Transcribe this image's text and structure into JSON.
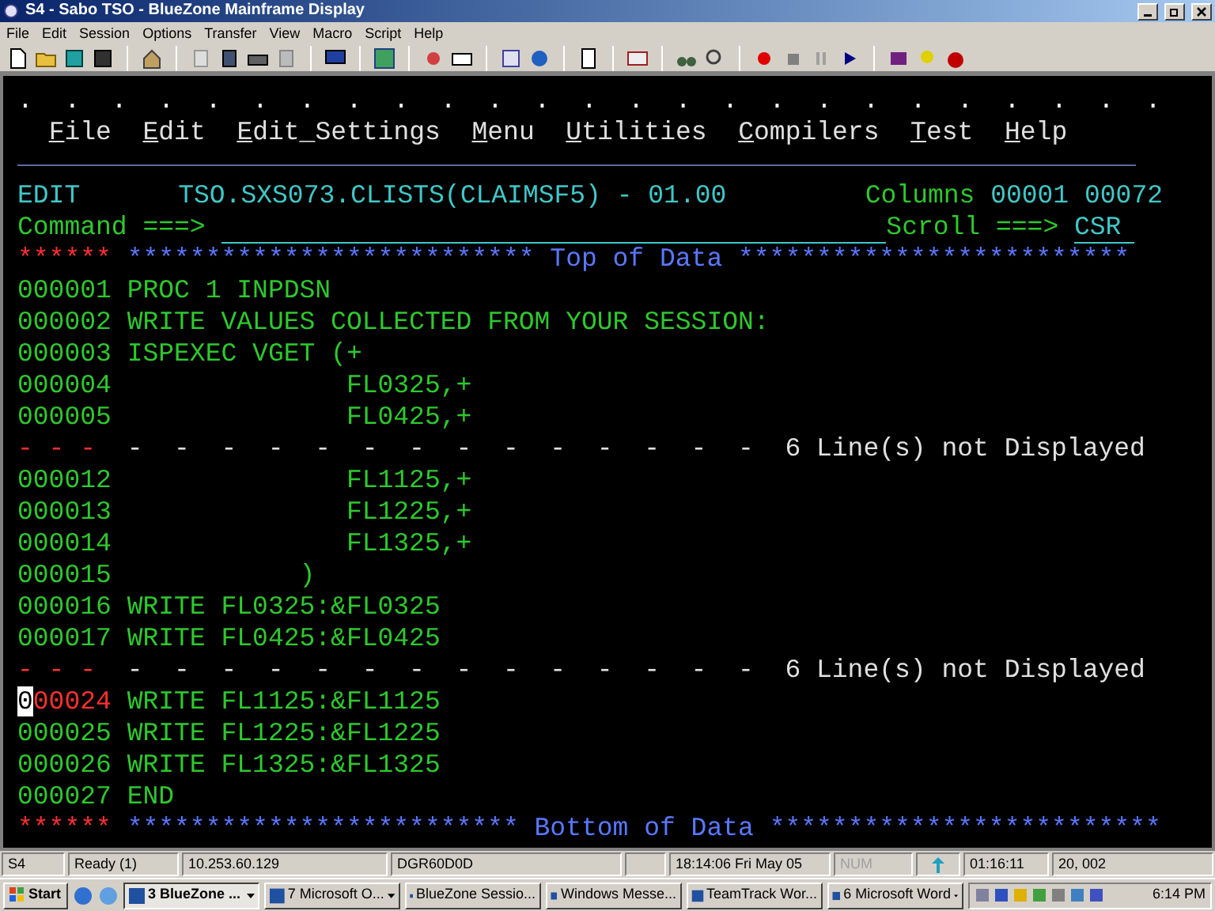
{
  "window": {
    "title": "S4 - Sabo TSO - BlueZone Mainframe Display"
  },
  "menu_bar": [
    "File",
    "Edit",
    "Session",
    "Options",
    "Transfer",
    "View",
    "Macro",
    "Script",
    "Help"
  ],
  "terminal": {
    "dots": ".  .  .  .  .  .  .  .  .  .  .  .  .  .  .  .  .  .  .  .  .  .  .  .  .",
    "ispf_menu": [
      "File",
      "Edit",
      "Edit_Settings",
      "Menu",
      "Utilities",
      "Compilers",
      "Test",
      "Help"
    ],
    "header": {
      "mode": "EDIT",
      "dataset": "TSO.SXS073.CLISTS(CLAIMSF5) - 01.00",
      "columns_label": "Columns",
      "columns_value": "00001 00072"
    },
    "command": {
      "label": "Command ===>",
      "scroll_label": "Scroll ===>",
      "scroll_value": "CSR"
    },
    "lines": [
      {
        "kind": "banner",
        "stars_left": "****** **************************",
        "label": "Top of Data",
        "stars_right": "*************************"
      },
      {
        "kind": "data",
        "number": "000001",
        "text": "PROC 1 INPDSN",
        "marked": false
      },
      {
        "kind": "data",
        "number": "000002",
        "text": "WRITE VALUES COLLECTED FROM YOUR SESSION:",
        "marked": false
      },
      {
        "kind": "data",
        "number": "000003",
        "text": "ISPEXEC VGET (+",
        "marked": false
      },
      {
        "kind": "data",
        "number": "000004",
        "text": "              FL0325,+",
        "marked": false
      },
      {
        "kind": "data",
        "number": "000005",
        "text": "              FL0425,+",
        "marked": false
      },
      {
        "kind": "excluded",
        "prefix": "- - -",
        "dashes": "  -  -  -  -  -  -  -  -  -  -  -  -  -  -",
        "label": "6 Line(s) not Displayed"
      },
      {
        "kind": "data",
        "number": "000012",
        "text": "              FL1125,+",
        "marked": false
      },
      {
        "kind": "data",
        "number": "000013",
        "text": "              FL1225,+",
        "marked": false
      },
      {
        "kind": "data",
        "number": "000014",
        "text": "              FL1325,+",
        "marked": false
      },
      {
        "kind": "data",
        "number": "000015",
        "text": "           )",
        "marked": false
      },
      {
        "kind": "data",
        "number": "000016",
        "text": "WRITE FL0325:&FL0325",
        "marked": false
      },
      {
        "kind": "data",
        "number": "000017",
        "text": "WRITE FL0425:&FL0425",
        "marked": false
      },
      {
        "kind": "excluded",
        "prefix": "- - -",
        "dashes": "  -  -  -  -  -  -  -  -  -  -  -  -  -  -",
        "label": "6 Line(s) not Displayed"
      },
      {
        "kind": "data",
        "number": "000024",
        "text": "WRITE FL1125:&FL1125",
        "marked": true
      },
      {
        "kind": "data",
        "number": "000025",
        "text": "WRITE FL1225:&FL1225",
        "marked": false
      },
      {
        "kind": "data",
        "number": "000026",
        "text": "WRITE FL1325:&FL1325",
        "marked": false
      },
      {
        "kind": "data",
        "number": "000027",
        "text": "END",
        "marked": false
      },
      {
        "kind": "banner",
        "stars_left": "****** *************************",
        "label": "Bottom of Data",
        "stars_right": "*************************"
      }
    ]
  },
  "status_bar": [
    {
      "text": "S4",
      "disabled": false
    },
    {
      "text": "Ready (1)",
      "disabled": false
    },
    {
      "text": "10.253.60.129",
      "disabled": false
    },
    {
      "text": "DGR60D0D",
      "disabled": false
    },
    {
      "text": "18:14:06  Fri May 05",
      "disabled": false
    },
    {
      "text": "NUM",
      "disabled": true
    },
    {
      "text": "01:16:11",
      "disabled": false
    },
    {
      "text": "20, 002",
      "disabled": false
    }
  ],
  "taskbar": {
    "start": "Start",
    "buttons": [
      {
        "label": "3 BlueZone ...",
        "selected": true,
        "group": true
      },
      {
        "label": "7 Microsoft O...",
        "selected": false,
        "group": true
      },
      {
        "label": "BlueZone Sessio...",
        "selected": false,
        "group": false
      },
      {
        "label": "Windows Messe...",
        "selected": false,
        "group": false
      },
      {
        "label": "TeamTrack Wor...",
        "selected": false,
        "group": false
      },
      {
        "label": "6 Microsoft Word",
        "selected": false,
        "group": true
      }
    ],
    "clock": "6:14 PM"
  }
}
